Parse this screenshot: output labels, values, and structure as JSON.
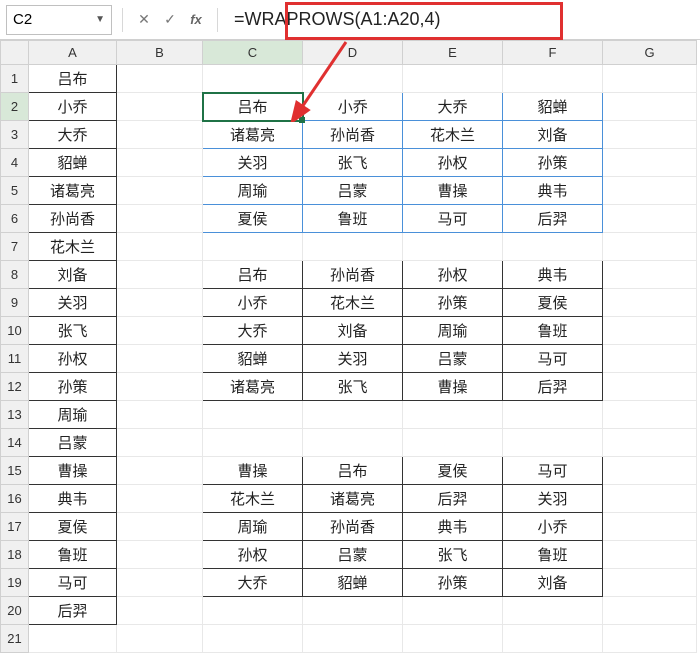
{
  "name_box": "C2",
  "formula": "=WRAPROWS(A1:A20,4)",
  "cols": [
    "A",
    "B",
    "C",
    "D",
    "E",
    "F",
    "G"
  ],
  "rows": [
    "1",
    "2",
    "3",
    "4",
    "5",
    "6",
    "7",
    "8",
    "9",
    "10",
    "11",
    "12",
    "13",
    "14",
    "15",
    "16",
    "17",
    "18",
    "19",
    "20",
    "21"
  ],
  "colA": [
    "吕布",
    "小乔",
    "大乔",
    "貂蝉",
    "诸葛亮",
    "孙尚香",
    "花木兰",
    "刘备",
    "关羽",
    "张飞",
    "孙权",
    "孙策",
    "周瑜",
    "吕蒙",
    "曹操",
    "典韦",
    "夏侯",
    "鲁班",
    "马可",
    "后羿"
  ],
  "block1": [
    [
      "吕布",
      "小乔",
      "大乔",
      "貂蝉"
    ],
    [
      "诸葛亮",
      "孙尚香",
      "花木兰",
      "刘备"
    ],
    [
      "关羽",
      "张飞",
      "孙权",
      "孙策"
    ],
    [
      "周瑜",
      "吕蒙",
      "曹操",
      "典韦"
    ],
    [
      "夏侯",
      "鲁班",
      "马可",
      "后羿"
    ]
  ],
  "block2": [
    [
      "吕布",
      "孙尚香",
      "孙权",
      "典韦"
    ],
    [
      "小乔",
      "花木兰",
      "孙策",
      "夏侯"
    ],
    [
      "大乔",
      "刘备",
      "周瑜",
      "鲁班"
    ],
    [
      "貂蝉",
      "关羽",
      "吕蒙",
      "马可"
    ],
    [
      "诸葛亮",
      "张飞",
      "曹操",
      "后羿"
    ]
  ],
  "block3": [
    [
      "曹操",
      "吕布",
      "夏侯",
      "马可"
    ],
    [
      "花木兰",
      "诸葛亮",
      "后羿",
      "关羽"
    ],
    [
      "周瑜",
      "孙尚香",
      "典韦",
      "小乔"
    ],
    [
      "孙权",
      "吕蒙",
      "张飞",
      "鲁班"
    ],
    [
      "大乔",
      "貂蝉",
      "孙策",
      "刘备"
    ]
  ]
}
